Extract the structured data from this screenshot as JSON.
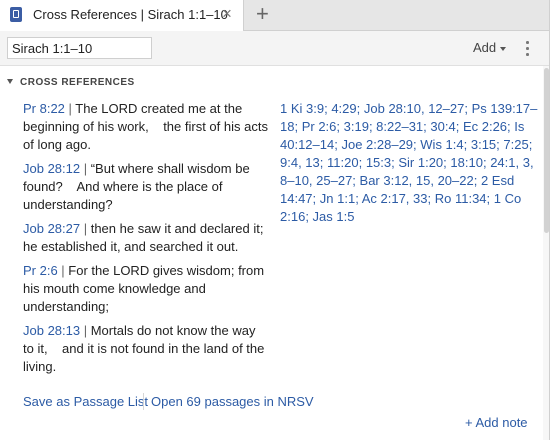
{
  "tab": {
    "title": "Cross References | Sirach 1:1–10",
    "close_glyph": "×",
    "new_tab_glyph": "+"
  },
  "toolbar": {
    "reference_value": "Sirach 1:1–10",
    "add_label": "Add"
  },
  "section": {
    "title": "CROSS REFERENCES"
  },
  "verses": [
    {
      "ref": "Pr 8:22",
      "sep": " | ",
      "text": "The LORD created me at the beginning of his work,    the first of his acts of long ago."
    },
    {
      "ref": "Job 28:12",
      "sep": " | ",
      "text": "“But where shall wisdom be found?    And where is the place of understanding?"
    },
    {
      "ref": "Job 28:27",
      "sep": " | ",
      "text": "then he saw it and declared it; he established it, and searched it out."
    },
    {
      "ref": "Pr 2:6",
      "sep": " | ",
      "text": "For the LORD gives wisdom; from his mouth come knowledge and understanding;"
    },
    {
      "ref": "Job 28:13",
      "sep": " | ",
      "text": "Mortals do not know the way to it,    and it is not found in the land of the living."
    }
  ],
  "cross_references": [
    "1 Ki 3:9",
    "4:29",
    "Job 28:10, 12–27",
    "Ps 139:17–18",
    "Pr 2:6",
    "3:19",
    "8:22–31",
    "30:4",
    "Ec 2:26",
    "Is 40:12–14",
    "Joe 2:28–29",
    "Wis 1:4",
    "3:15",
    "7:25",
    "9:4, 13",
    "11:20",
    "15:3",
    "Sir 1:20",
    "18:10",
    "24:1, 3, 8–10, 25–27",
    "Bar 3:12, 15, 20–22",
    "2 Esd 14:47",
    "Jn 1:1",
    "Ac 2:17, 33",
    "Ro 11:34",
    "1 Co 2:16",
    "Jas 1:5"
  ],
  "footer": {
    "save_label": "Save as Passage List",
    "open_label": "Open 69 passages in NRSV",
    "add_note_label": "+ Add note"
  },
  "colors": {
    "link": "#2c5ba5",
    "tab_icon": "#3b5da4"
  }
}
